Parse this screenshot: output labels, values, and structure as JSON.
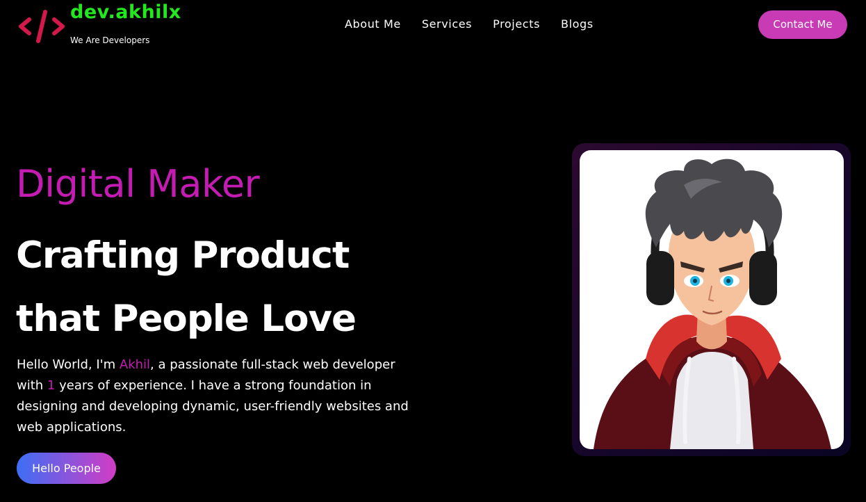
{
  "colors": {
    "brand_green": "#22e81e",
    "accent_magenta": "#c41bb3",
    "logo_red": "#d3184a",
    "button_magenta": "#c93bb5",
    "gradient_start": "#3c6ff5",
    "gradient_end": "#d23cc4",
    "background": "#000000"
  },
  "brand": {
    "logo_icon": "code-brackets-icon",
    "name": "dev.akhilx",
    "tagline": "We Are Developers"
  },
  "nav": {
    "items": [
      {
        "label": "About Me"
      },
      {
        "label": "Services"
      },
      {
        "label": "Projects"
      },
      {
        "label": "Blogs"
      }
    ]
  },
  "header": {
    "contact_label": "Contact Me"
  },
  "hero": {
    "eyebrow": "Digital Maker",
    "title_line1": "Crafting Product",
    "title_line2": "that People Love",
    "desc_part1": "Hello World, I'm ",
    "desc_name": "Akhil",
    "desc_part2": ", a passionate full-stack web developer with ",
    "desc_years": "1",
    "desc_part3": " years of experience. I have a strong foundation in designing and developing dynamic, user-friendly websites and web applications.",
    "cta_label": "Hello People"
  },
  "avatar": {
    "icon": "anime-developer-avatar"
  }
}
